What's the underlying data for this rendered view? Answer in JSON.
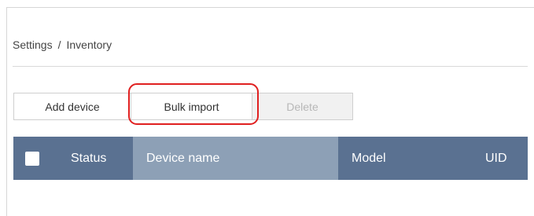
{
  "breadcrumb": {
    "parent": "Settings",
    "separator": "/",
    "current": "Inventory"
  },
  "toolbar": {
    "add_label": "Add device",
    "bulk_label": "Bulk import",
    "delete_label": "Delete"
  },
  "table": {
    "columns": [
      "Status",
      "Device name",
      "Model",
      "UID"
    ],
    "sorted_column": "Device name"
  },
  "colors": {
    "header_bg": "#5a7191",
    "sorted_col_bg": "#8da0b6",
    "highlight": "#e02020"
  }
}
